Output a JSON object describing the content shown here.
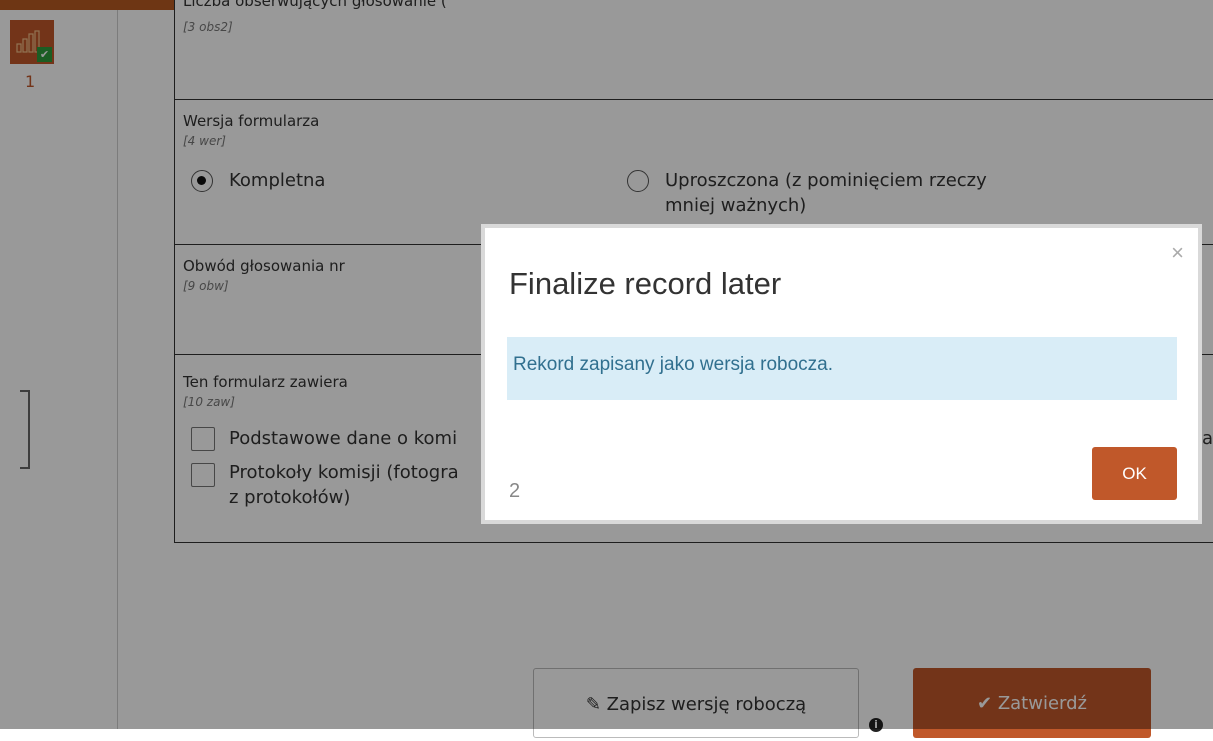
{
  "rail": {
    "page_number": "1"
  },
  "sections": [
    {
      "label": "Liczba obserwujących głosowanie (",
      "code": "[3 obs2]"
    },
    {
      "label": "Wersja formularza",
      "code": "[4 wer]",
      "options": [
        {
          "label": "Kompletna",
          "selected": true
        },
        {
          "label_line1": "Uproszczona (z pominięciem rzeczy",
          "label_line2": "mniej ważnych)",
          "selected": false
        }
      ]
    },
    {
      "label": "Obwód głosowania nr",
      "code": "[9 obw]"
    },
    {
      "label": "Ten formularz zawiera",
      "code": "[10 zaw]",
      "checkboxes": [
        {
          "label": "Podstawowe dane o komi"
        },
        {
          "label_line1": "Protokoły komisji (fotogra",
          "label_line2": "z protokołów)"
        }
      ],
      "clipped_right_text": "a"
    }
  ],
  "buttons": {
    "draft_label": "Zapisz wersję roboczą",
    "submit_label": "Zatwierdź"
  },
  "modal": {
    "title": "Finalize record later",
    "close": "×",
    "message": "Rekord zapisany jako wersja robocza.",
    "number": "2",
    "ok_label": "OK"
  },
  "colors": {
    "accent": "#c0582a",
    "alert_bg": "#d9edf7",
    "alert_text": "#31708f"
  }
}
